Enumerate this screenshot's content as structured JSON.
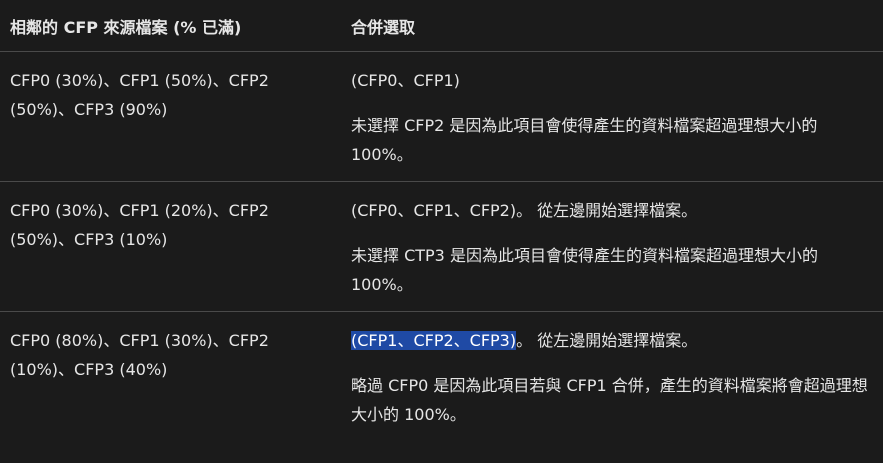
{
  "table": {
    "headers": [
      "相鄰的 CFP 來源檔案 (% 已滿)",
      "合併選取"
    ],
    "rows": [
      {
        "sources": "CFP0 (30%)、CFP1 (50%)、CFP2 (50%)、CFP3 (90%)",
        "selection_highlight": "",
        "selection_rest": "(CFP0、CFP1)",
        "note": "未選擇 CFP2 是因為此項目會使得產生的資料檔案超過理想大小的 100%。"
      },
      {
        "sources": "CFP0 (30%)、CFP1 (20%)、CFP2 (50%)、CFP3 (10%)",
        "selection_highlight": "",
        "selection_rest": "(CFP0、CFP1、CFP2)。 從左邊開始選擇檔案。",
        "note": "未選擇 CTP3 是因為此項目會使得產生的資料檔案超過理想大小的 100%。"
      },
      {
        "sources": "CFP0 (80%)、CFP1 (30%)、CFP2 (10%)、CFP3 (40%)",
        "selection_highlight": "(CFP1、CFP2、CFP3)",
        "selection_rest": "。 從左邊開始選擇檔案。",
        "note": "略過 CFP0 是因為此項目若與 CFP1 合併，產生的資料檔案將會超過理想大小的 100%。"
      }
    ]
  }
}
